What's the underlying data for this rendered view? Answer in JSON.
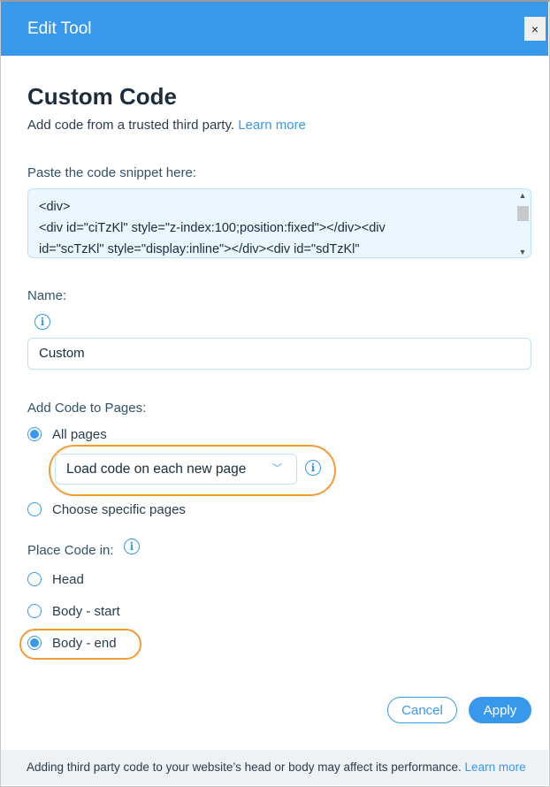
{
  "window": {
    "title": "Edit Tool",
    "close_label": "×"
  },
  "page": {
    "title": "Custom Code",
    "subtitle": "Add code from a trusted third party.",
    "subtitle_link": "Learn more"
  },
  "code": {
    "label": "Paste the code snippet here:",
    "lines": [
      "<div>",
      "<div id=\"ciTzKl\" style=\"z-index:100;position:fixed\"></div><div",
      "id=\"scTzKl\" style=\"display:inline\"></div><div id=\"sdTzKl\""
    ]
  },
  "name": {
    "label": "Name:",
    "value": "Custom",
    "info_icon": "i"
  },
  "pages": {
    "label": "Add Code to Pages:",
    "options": [
      {
        "label": "All pages",
        "selected": true
      },
      {
        "label": "Choose specific pages",
        "selected": false
      }
    ],
    "load_select": "Load code on each new page",
    "info_icon": "i"
  },
  "placement": {
    "label": "Place Code in:",
    "info_icon": "i",
    "options": [
      {
        "label": "Head",
        "selected": false
      },
      {
        "label": "Body - start",
        "selected": false
      },
      {
        "label": "Body - end",
        "selected": true
      }
    ]
  },
  "buttons": {
    "cancel": "Cancel",
    "apply": "Apply"
  },
  "footer": {
    "text": "Adding third party code to your website’s head or body may affect its performance.",
    "link": "Learn more"
  },
  "colors": {
    "accent": "#3899ec",
    "highlight": "#f79a35",
    "footer_bg": "#eff2f5"
  }
}
